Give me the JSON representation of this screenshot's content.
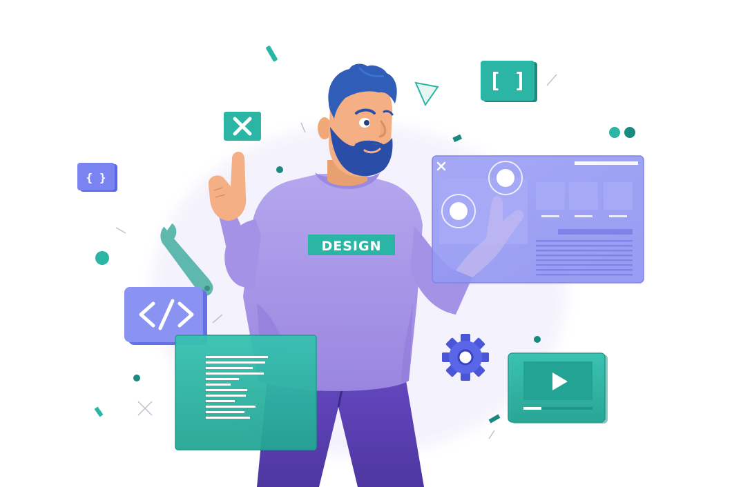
{
  "illustration": {
    "shirt_text": "DESIGN",
    "code_symbol": "</>",
    "bracket_large": "[ ]",
    "bracket_small": "{ }",
    "close_symbol": "×",
    "play_symbol": "▶"
  },
  "palette": {
    "teal": "#2bb5a5",
    "teal_dark": "#1a8a7f",
    "purple_shirt": "#a894e8",
    "purple_dark": "#7862cf",
    "blue_panel": "#8a8ff0",
    "hair": "#2f5db7",
    "beard": "#2a4ea8",
    "skin": "#f4b084",
    "pants": "#5a3fb0"
  }
}
